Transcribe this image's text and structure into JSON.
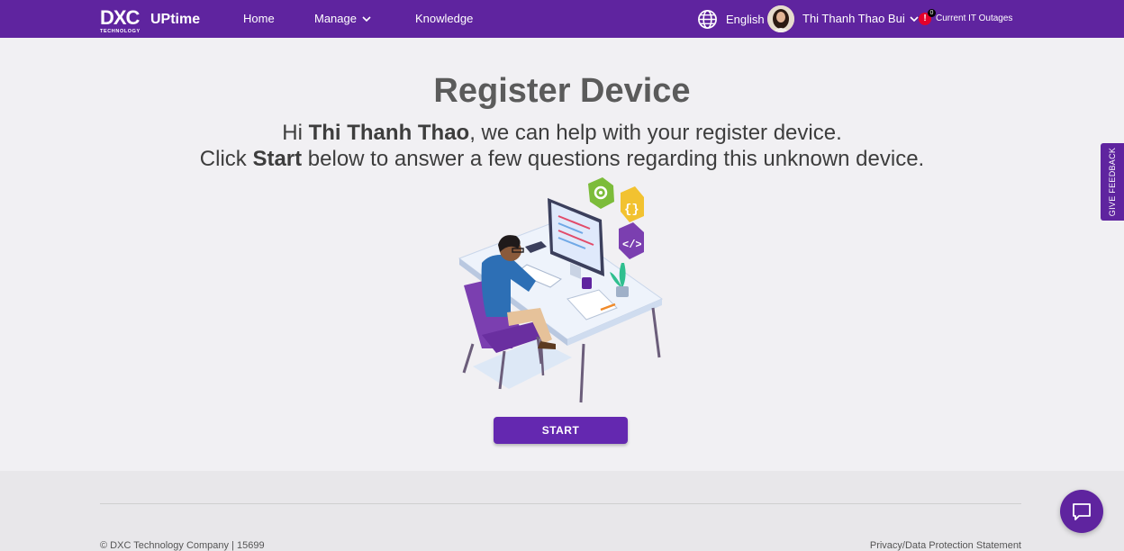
{
  "header": {
    "logo_text": "DXC",
    "logo_sub": "TECHNOLOGY",
    "brand": "UPtime",
    "nav": {
      "home": "Home",
      "manage": "Manage",
      "knowledge": "Knowledge"
    },
    "language": "English",
    "user_name": "Thi Thanh Thao Bui",
    "alert_icon_text": "!",
    "alert_count": "0",
    "outages_label": "Current IT Outages"
  },
  "main": {
    "title": "Register Device",
    "greeting_prefix": "Hi ",
    "user_first": "Thi Thanh Thao",
    "greeting_suffix": ", we can help with your register device.",
    "instruction_prefix": "Click ",
    "instruction_bold": "Start",
    "instruction_suffix": " below to answer a few questions regarding this unknown device.",
    "start_button": "START"
  },
  "feedback_tab": "GIVE FEEDBACK",
  "footer": {
    "copyright": "© DXC Technology Company | 15699",
    "privacy": "Privacy/Data Protection Statement"
  },
  "colors": {
    "brand_purple": "#5f249f",
    "button_purple": "#6428b0",
    "alert_red": "#e4002b"
  }
}
